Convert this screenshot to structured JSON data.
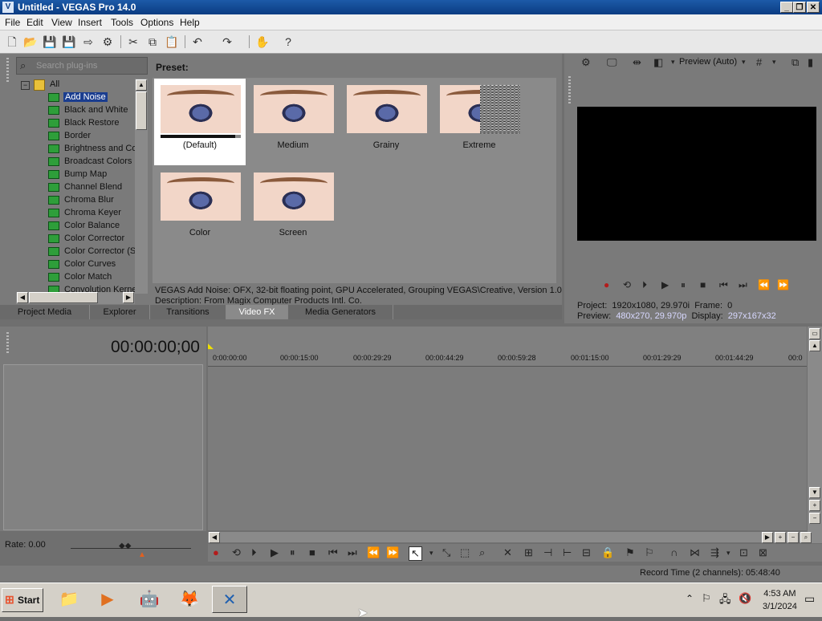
{
  "window": {
    "title": "Untitled - VEGAS Pro 14.0",
    "minimize": "_",
    "maximize": "❐",
    "close": "✕"
  },
  "menu": [
    "File",
    "Edit",
    "View",
    "Insert",
    "Tools",
    "Options",
    "Help"
  ],
  "plugins": {
    "search_placeholder": "Search plug-ins",
    "root": "All",
    "items": [
      "Add Noise",
      "Black and White",
      "Black Restore",
      "Border",
      "Brightness and Co",
      "Broadcast Colors",
      "Bump Map",
      "Channel Blend",
      "Chroma Blur",
      "Chroma Keyer",
      "Color Balance",
      "Color Corrector",
      "Color Corrector (S",
      "Color Curves",
      "Color Match",
      "Convolution Kerne"
    ],
    "selected": "Add Noise"
  },
  "presets": {
    "label": "Preset:",
    "items": [
      {
        "name": "(Default)",
        "selected": true,
        "progress": 0.93
      },
      {
        "name": "Medium"
      },
      {
        "name": "Grainy"
      },
      {
        "name": "Extreme"
      },
      {
        "name": "Color"
      },
      {
        "name": "Screen"
      }
    ],
    "description_line1": "VEGAS Add Noise: OFX, 32-bit floating point, GPU Accelerated, Grouping VEGAS\\Creative, Version 1.0",
    "description_line2": "Description: From Magix Computer Products Intl. Co."
  },
  "tabs": [
    "Project Media",
    "Explorer",
    "Transitions",
    "Video FX",
    "Media Generators"
  ],
  "active_tab": "Video FX",
  "preview": {
    "mode": "Preview (Auto)",
    "project_label": "Project:",
    "project_value": "1920x1080, 29.970i",
    "frame_label": "Frame:",
    "frame_value": "0",
    "preview_label": "Preview:",
    "preview_value": "480x270, 29.970p",
    "display_label": "Display:",
    "display_value": "297x167x32"
  },
  "timeline": {
    "timecode": "00:00:00;00",
    "ruler": [
      "0:00:00:00",
      "00:00:15:00",
      "00:00:29:29",
      "00:00:44:29",
      "00:00:59:28",
      "00:01:15:00",
      "00:01:29:29",
      "00:01:44:29",
      "00:0"
    ],
    "rate": "Rate: 0.00",
    "record_time": "Record Time (2 channels): 05:48:40"
  },
  "taskbar": {
    "start": "Start",
    "time": "4:53 AM",
    "date": "3/1/2024"
  },
  "colors": {
    "titlebar": "#0b3c82",
    "selection": "#1a3d8f",
    "panel": "#7a7a7a"
  }
}
